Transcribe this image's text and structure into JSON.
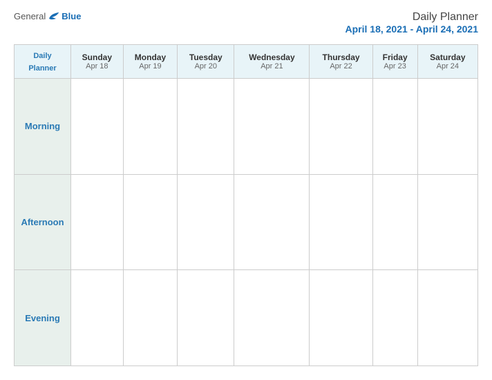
{
  "logo": {
    "general": "General",
    "blue": "Blue"
  },
  "header": {
    "title": "Daily Planner",
    "date_range": "April 18, 2021 - April 24, 2021"
  },
  "table": {
    "corner_label_line1": "Daily",
    "corner_label_line2": "Planner",
    "days": [
      {
        "name": "Sunday",
        "date": "Apr 18"
      },
      {
        "name": "Monday",
        "date": "Apr 19"
      },
      {
        "name": "Tuesday",
        "date": "Apr 20"
      },
      {
        "name": "Wednesday",
        "date": "Apr 21"
      },
      {
        "name": "Thursday",
        "date": "Apr 22"
      },
      {
        "name": "Friday",
        "date": "Apr 23"
      },
      {
        "name": "Saturday",
        "date": "Apr 24"
      }
    ],
    "time_slots": [
      "Morning",
      "Afternoon",
      "Evening"
    ]
  }
}
